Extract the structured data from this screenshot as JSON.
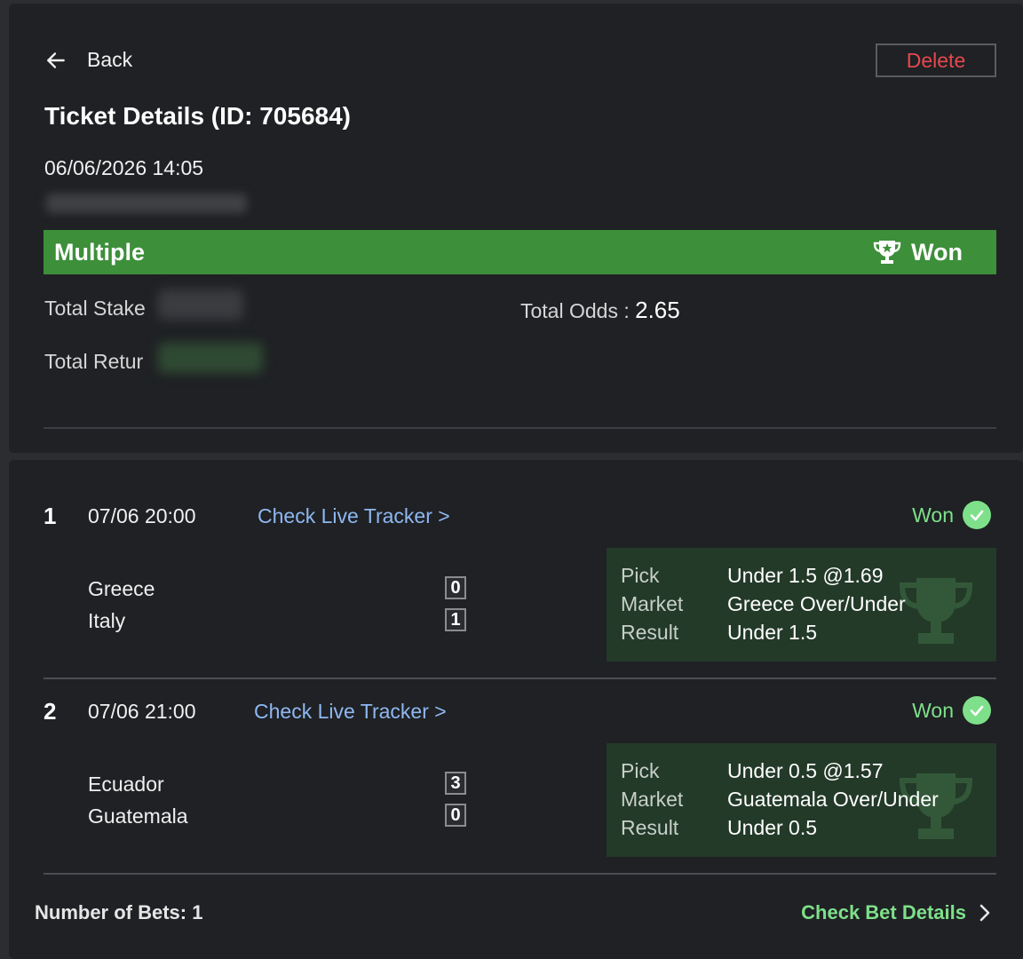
{
  "header": {
    "back_label": "Back",
    "delete_label": "Delete",
    "title": "Ticket Details (ID: 705684)",
    "datetime": "06/06/2026 14:05"
  },
  "ticket": {
    "type": "Multiple",
    "status": "Won",
    "total_stake_label": "Total Stake",
    "total_odds_label": "Total Odds :",
    "total_odds_value": "2.65",
    "total_return_label": "Total Retur"
  },
  "legs": [
    {
      "number": "1",
      "time": "07/06 20:00",
      "tracker_label": "Check Live Tracker >",
      "status": "Won",
      "home": "Greece",
      "away": "Italy",
      "home_score": "0",
      "away_score": "1",
      "pick_label": "Pick",
      "pick_value": "Under 1.5 @1.69",
      "market_label": "Market",
      "market_value": "Greece Over/Under",
      "result_label": "Result",
      "result_value": "Under 1.5"
    },
    {
      "number": "2",
      "time": "07/06 21:00",
      "tracker_label": "Check Live Tracker >",
      "status": "Won",
      "home": "Ecuador",
      "away": "Guatemala",
      "home_score": "3",
      "away_score": "0",
      "pick_label": "Pick",
      "pick_value": "Under 0.5 @1.57",
      "market_label": "Market",
      "market_value": "Guatemala Over/Under",
      "result_label": "Result",
      "result_value": "Under 0.5"
    }
  ],
  "footer": {
    "bets_count_label": "Number of Bets: 1",
    "check_details_label": "Check Bet Details"
  },
  "colors": {
    "background": "#1f2124",
    "won_green": "#7ee08a",
    "ticket_bar": "#3d8f3a",
    "pick_box": "#233a28",
    "link_blue": "#8fb8f2",
    "delete_red": "#e5484d"
  },
  "icons": [
    "arrow-left-icon",
    "trophy-icon",
    "check-circle-icon",
    "chevron-right-icon"
  ]
}
